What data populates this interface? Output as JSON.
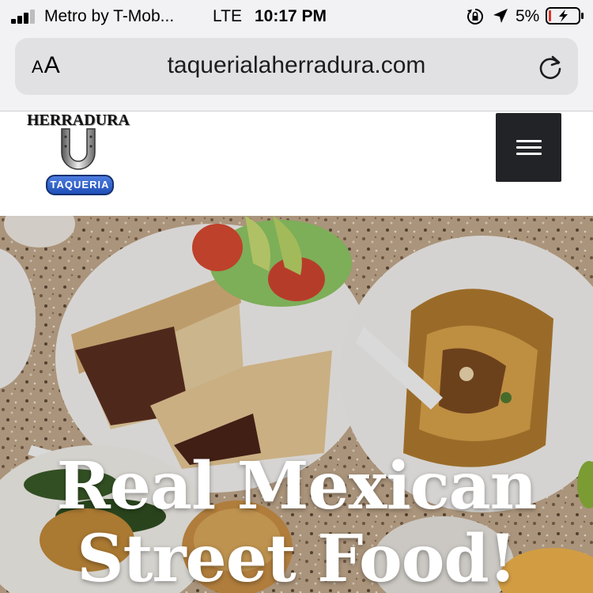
{
  "status_bar": {
    "carrier": "Metro by T-Mob...",
    "network": "LTE",
    "time": "10:17 PM",
    "battery_percent": "5%",
    "icons": [
      "signal-icon",
      "orientation-lock-icon",
      "location-arrow-icon",
      "battery-charging-icon"
    ]
  },
  "browser": {
    "text_size_label_small": "A",
    "text_size_label_large": "A",
    "url": "taquerialaherradura.com",
    "icons": [
      "reload-icon"
    ]
  },
  "header": {
    "logo_title": "HERRADURA",
    "logo_badge": "TAQUERIA",
    "icons": [
      "horseshoe-icon",
      "hamburger-menu-icon"
    ]
  },
  "hero": {
    "heading_line1": "Real Mexican",
    "heading_line2": "Street Food!"
  },
  "colors": {
    "browser_chrome": "#f2f2f4",
    "url_pill": "#e1e1e4",
    "menu_button": "#222327",
    "badge_blue": "#2a5cc8",
    "battery_low": "#e0332a"
  }
}
